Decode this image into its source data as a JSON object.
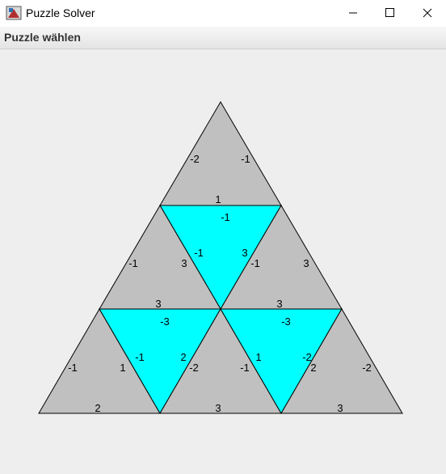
{
  "window": {
    "title": "Puzzle Solver"
  },
  "menu": {
    "items": [
      {
        "label": "Puzzle wählen"
      }
    ]
  },
  "colors": {
    "gray_tile": "#c0c0c0",
    "cyan_tile": "#00ffff",
    "edge": "#000000"
  },
  "puzzle": {
    "tiles": [
      {
        "name": "tile-top",
        "color": "gray",
        "labels": [
          "-2",
          "-1",
          "1"
        ]
      },
      {
        "name": "tile-center-upper",
        "color": "cyan",
        "labels": [
          "-1",
          "-1",
          "3"
        ]
      },
      {
        "name": "tile-mid-left",
        "color": "gray",
        "labels": [
          "-1",
          "3",
          "3"
        ]
      },
      {
        "name": "tile-mid-right",
        "color": "gray",
        "labels": [
          "3",
          "-1",
          "3"
        ]
      },
      {
        "name": "tile-bottom-left",
        "color": "gray",
        "labels": [
          "-1",
          "1",
          "2"
        ]
      },
      {
        "name": "tile-cyan-left",
        "color": "cyan",
        "labels": [
          "-3",
          "-1",
          "2"
        ]
      },
      {
        "name": "tile-bottom-center",
        "color": "gray",
        "labels": [
          "-2",
          "-1",
          "3"
        ]
      },
      {
        "name": "tile-cyan-right",
        "color": "cyan",
        "labels": [
          "-3",
          "1",
          "-2"
        ]
      },
      {
        "name": "tile-bottom-right",
        "color": "gray",
        "labels": [
          "2",
          "-2",
          "3"
        ]
      }
    ]
  }
}
